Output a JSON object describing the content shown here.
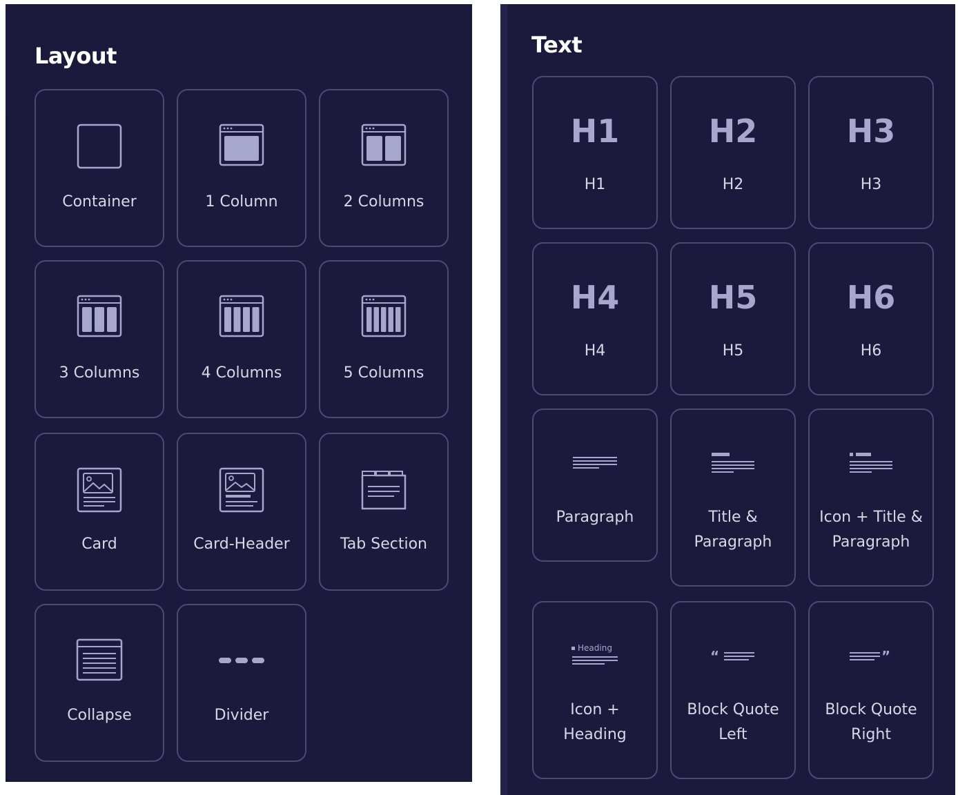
{
  "layout": {
    "title": "Layout",
    "items": [
      {
        "label": "Container"
      },
      {
        "label": "1 Column"
      },
      {
        "label": "2 Columns"
      },
      {
        "label": "3 Columns"
      },
      {
        "label": "4 Columns"
      },
      {
        "label": "5 Columns"
      },
      {
        "label": "Card"
      },
      {
        "label": "Card-Header"
      },
      {
        "label": "Tab Section"
      },
      {
        "label": "Collapse"
      },
      {
        "label": "Divider"
      }
    ]
  },
  "text": {
    "title": "Text",
    "items": [
      {
        "glyph": "H1",
        "label": "H1"
      },
      {
        "glyph": "H2",
        "label": "H2"
      },
      {
        "glyph": "H3",
        "label": "H3"
      },
      {
        "glyph": "H4",
        "label": "H4"
      },
      {
        "glyph": "H5",
        "label": "H5"
      },
      {
        "glyph": "H6",
        "label": "H6"
      },
      {
        "label_line1": "Paragraph"
      },
      {
        "label_line1": "Title &",
        "label_line2": "Paragraph"
      },
      {
        "label_line1": "Icon + Title &",
        "label_line2": "Paragraph"
      },
      {
        "icon_text": "Heading",
        "label_line1": "Icon +",
        "label_line2": "Heading"
      },
      {
        "label_line1": "Block Quote",
        "label_line2": "Left"
      },
      {
        "label_line1": "Block Quote",
        "label_line2": "Right"
      }
    ]
  },
  "colors": {
    "panel_bg": "#1b1a3c",
    "tile_border": "#4a4a72",
    "icon_fill": "#a7a6cd",
    "label_text": "#d7d7e6"
  }
}
